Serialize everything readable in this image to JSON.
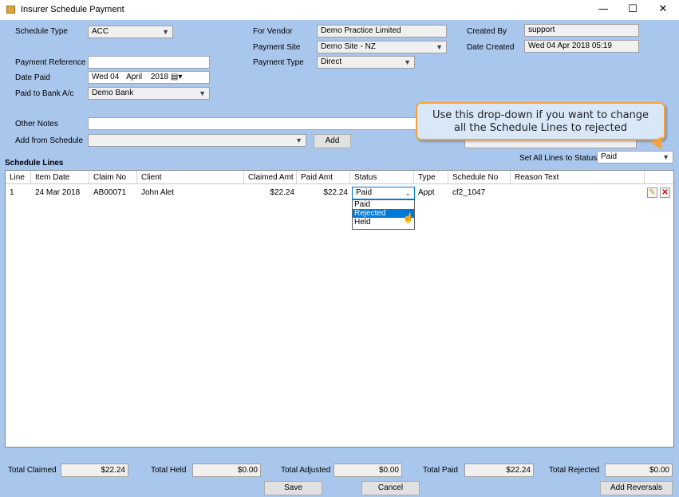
{
  "window": {
    "title": "Insurer Schedule Payment",
    "minimize": "—",
    "maximize": "☐",
    "close": "✕"
  },
  "form": {
    "schedule_type_label": "Schedule Type",
    "schedule_type_value": "ACC",
    "for_vendor_label": "For Vendor",
    "for_vendor_value": "Demo Practice Limited",
    "created_by_label": "Created By",
    "created_by_value": "support",
    "payment_site_label": "Payment Site",
    "payment_site_value": "Demo Site - NZ",
    "date_created_label": "Date Created",
    "date_created_value": "Wed 04 Apr 2018 05:19",
    "payment_reference_label": "Payment Reference",
    "payment_reference_value": "",
    "payment_type_label": "Payment Type",
    "payment_type_value": "Direct",
    "date_paid_label": "Date Paid",
    "date_paid_day": "Wed 04",
    "date_paid_month": "April",
    "date_paid_year": "2018",
    "paid_to_bank_label": "Paid to Bank A/c",
    "paid_to_bank_value": "Demo Bank",
    "other_notes_label": "Other Notes",
    "other_notes_value": "",
    "add_from_schedule_label": "Add from Schedule",
    "add_from_schedule_value": "",
    "add_button": "Add",
    "set_all_label": "Set All Lines to Status",
    "set_all_value": "Paid"
  },
  "callout": {
    "line1": "Use this drop-down if you want to change",
    "line2": "all the Schedule Lines to rejected"
  },
  "schedule_lines": {
    "title": "Schedule Lines",
    "headers": [
      "Line",
      "Item Date",
      "Claim No",
      "Client",
      "Claimed Amt",
      "Paid Amt",
      "Status",
      "Type",
      "Schedule No",
      "Reason Text"
    ],
    "rows": [
      {
        "line": "1",
        "item_date": "24 Mar 2018",
        "claim_no": "AB00071",
        "client": "John Alet",
        "claimed_amt": "$22.24",
        "paid_amt": "$22.24",
        "status": "Paid",
        "type": "Appt",
        "schedule_no": "cf2_1047",
        "reason_text": ""
      }
    ],
    "status_options": [
      "Paid",
      "Rejected",
      "Held"
    ],
    "highlighted_option": "Rejected"
  },
  "totals": {
    "claimed_label": "Total Claimed",
    "claimed_value": "$22.24",
    "held_label": "Total Held",
    "held_value": "$0.00",
    "adjusted_label": "Total Adjusted",
    "adjusted_value": "$0.00",
    "paid_label": "Total Paid",
    "paid_value": "$22.24",
    "rejected_label": "Total Rejected",
    "rejected_value": "$0.00"
  },
  "footer": {
    "save": "Save",
    "cancel": "Cancel",
    "add_reversals": "Add Reversals"
  },
  "colors": {
    "background": "#A9C6EC",
    "callout_border": "#F4A23C",
    "selection": "#0078D7"
  }
}
